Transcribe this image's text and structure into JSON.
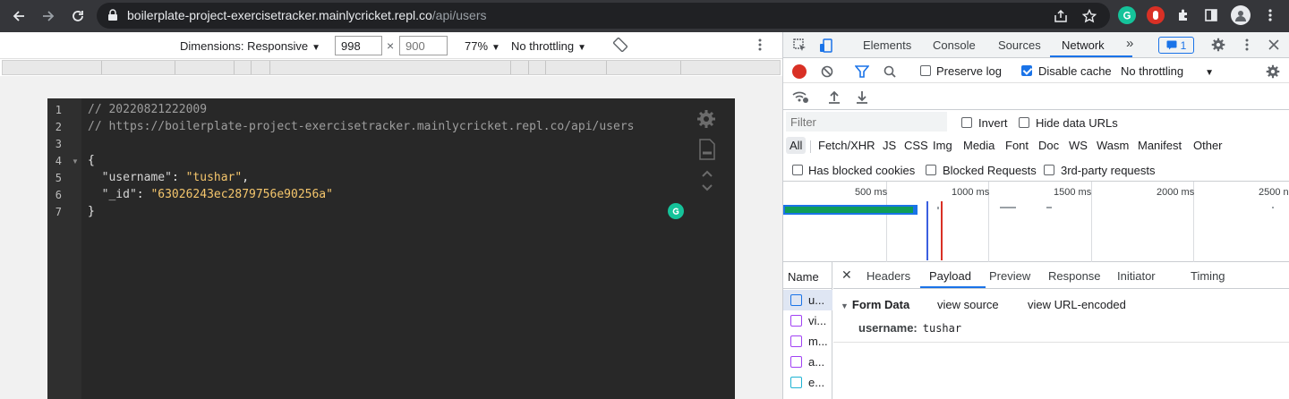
{
  "browser": {
    "url_host": "boilerplate-project-exercisetracker.mainlycricket.repl.co",
    "url_path": "/api/users"
  },
  "device_toolbar": {
    "dimensions_label": "Dimensions: Responsive",
    "width": "998",
    "height": "900",
    "times": "×",
    "zoom": "77%",
    "throttling": "No throttling"
  },
  "editor": {
    "lines": [
      {
        "num": "1",
        "text": "// 20220821222009"
      },
      {
        "num": "2",
        "text": "// https://boilerplate-project-exercisetracker.mainlycricket.repl.co/api/users"
      },
      {
        "num": "3",
        "text": ""
      },
      {
        "num": "4",
        "text": "{"
      },
      {
        "num": "5",
        "key": "\"username\"",
        "sep": ": ",
        "value": "\"tushar\"",
        "tail": ","
      },
      {
        "num": "6",
        "key": "\"_id\"",
        "sep": ": ",
        "value": "\"63026243ec2879756e90256a\"",
        "tail": ""
      },
      {
        "num": "7",
        "text": "}"
      }
    ]
  },
  "devtools": {
    "tabs": [
      "Elements",
      "Console",
      "Sources",
      "Network"
    ],
    "active_tab": "Network",
    "issues_count": "1",
    "toolbar": {
      "preserve_log": "Preserve log",
      "disable_cache": "Disable cache",
      "throttling": "No throttling"
    },
    "filter_placeholder": "Filter",
    "invert": "Invert",
    "hide_data_urls": "Hide data URLs",
    "types": [
      "All",
      "Fetch/XHR",
      "JS",
      "CSS",
      "Img",
      "Media",
      "Font",
      "Doc",
      "WS",
      "Wasm",
      "Manifest",
      "Other"
    ],
    "has_blocked_cookies": "Has blocked cookies",
    "blocked_requests": "Blocked Requests",
    "third_party": "3rd-party requests",
    "timeline_labels": [
      "500 ms",
      "1000 ms",
      "1500 ms",
      "2000 ms",
      "2500 n"
    ],
    "name_header": "Name",
    "requests": [
      "u...",
      "vi...",
      "m...",
      "a...",
      "e..."
    ],
    "detail_tabs": [
      "Headers",
      "Payload",
      "Preview",
      "Response",
      "Initiator",
      "Timing"
    ],
    "active_detail_tab": "Payload",
    "form_data": {
      "title": "Form Data",
      "view_source": "view source",
      "view_url_encoded": "view URL-encoded",
      "key": "username:",
      "value": "tushar"
    }
  }
}
